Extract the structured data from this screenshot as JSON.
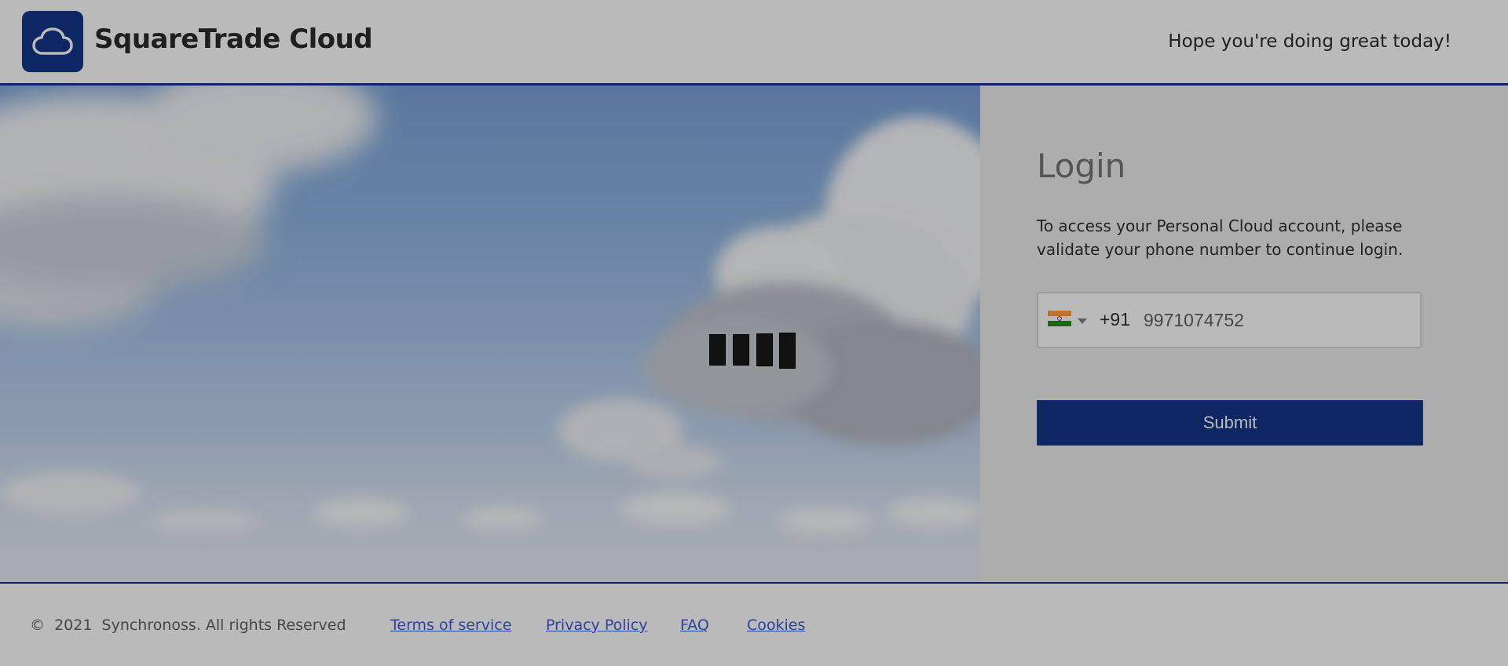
{
  "header": {
    "brand": "SquareTrade Cloud",
    "greeting": "Hope you're doing great today!"
  },
  "login": {
    "title": "Login",
    "description": "To access your Personal Cloud account, please validate your phone number to continue login.",
    "country_flag": "india-flag-icon",
    "dial_code": "+91",
    "phone_value": "9971074752",
    "submit_label": "Submit"
  },
  "footer": {
    "copyright": "©  2021  Synchronoss. All rights Reserved",
    "links": {
      "terms": "Terms of service",
      "privacy": "Privacy Policy",
      "faq": "FAQ",
      "cookies": "Cookies"
    }
  },
  "colors": {
    "brand_blue": "#002680",
    "link_blue": "#2f4fd6",
    "overlay": "rgba(40,40,40,0.32)"
  },
  "loading": {
    "visible": true,
    "icon": "loading-bars-icon"
  }
}
